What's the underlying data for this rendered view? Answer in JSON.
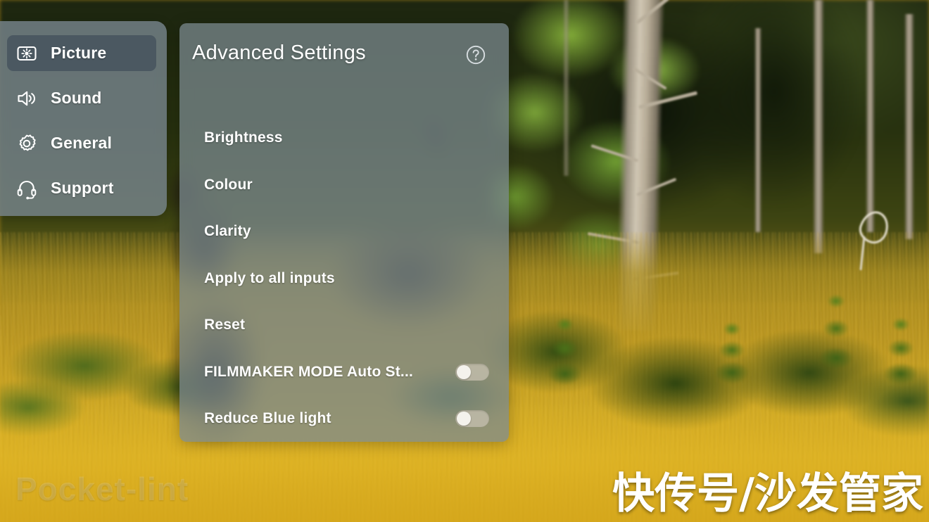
{
  "sidebar": {
    "items": [
      {
        "label": "Picture",
        "icon": "brightness-screen-icon",
        "selected": true
      },
      {
        "label": "Sound",
        "icon": "speaker-icon",
        "selected": false
      },
      {
        "label": "General",
        "icon": "gear-icon",
        "selected": false
      },
      {
        "label": "Support",
        "icon": "headset-icon",
        "selected": false
      }
    ]
  },
  "panel": {
    "title": "Advanced Settings",
    "help_icon": "help-circle-icon",
    "options": [
      {
        "label": "Brightness",
        "type": "link"
      },
      {
        "label": "Colour",
        "type": "link"
      },
      {
        "label": "Clarity",
        "type": "link"
      },
      {
        "label": "Apply to all inputs",
        "type": "link"
      },
      {
        "label": "Reset",
        "type": "link"
      },
      {
        "label": "FILMMAKER MODE Auto St...",
        "type": "toggle",
        "value": "off"
      },
      {
        "label": "Reduce Blue light",
        "type": "toggle",
        "value": "off"
      }
    ]
  },
  "watermarks": {
    "site": "Pocket-lint",
    "channel": "快传号/沙发管家"
  },
  "colors": {
    "panel_fill": "#7b8991",
    "sidebar_fill": "#78868e",
    "selected_row": "#46535e",
    "text": "#ffffff",
    "toggle_track_off": "#beb9a8",
    "toggle_knob": "#f4f2ec",
    "grass": "#cfa822",
    "forest_dark": "#1d2610"
  }
}
